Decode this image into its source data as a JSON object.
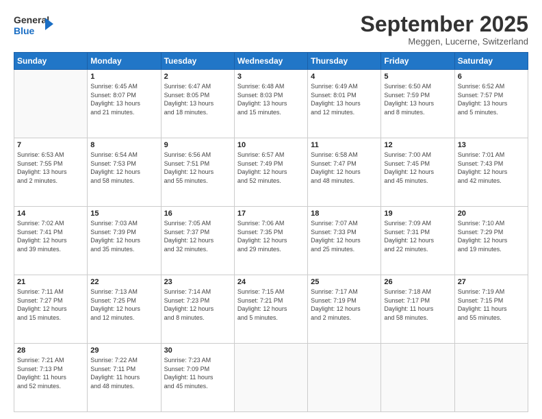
{
  "logo": {
    "line1": "General",
    "line2": "Blue"
  },
  "title": "September 2025",
  "subtitle": "Meggen, Lucerne, Switzerland",
  "header": {
    "days": [
      "Sunday",
      "Monday",
      "Tuesday",
      "Wednesday",
      "Thursday",
      "Friday",
      "Saturday"
    ]
  },
  "weeks": [
    [
      {
        "day": "",
        "info": ""
      },
      {
        "day": "1",
        "info": "Sunrise: 6:45 AM\nSunset: 8:07 PM\nDaylight: 13 hours\nand 21 minutes."
      },
      {
        "day": "2",
        "info": "Sunrise: 6:47 AM\nSunset: 8:05 PM\nDaylight: 13 hours\nand 18 minutes."
      },
      {
        "day": "3",
        "info": "Sunrise: 6:48 AM\nSunset: 8:03 PM\nDaylight: 13 hours\nand 15 minutes."
      },
      {
        "day": "4",
        "info": "Sunrise: 6:49 AM\nSunset: 8:01 PM\nDaylight: 13 hours\nand 12 minutes."
      },
      {
        "day": "5",
        "info": "Sunrise: 6:50 AM\nSunset: 7:59 PM\nDaylight: 13 hours\nand 8 minutes."
      },
      {
        "day": "6",
        "info": "Sunrise: 6:52 AM\nSunset: 7:57 PM\nDaylight: 13 hours\nand 5 minutes."
      }
    ],
    [
      {
        "day": "7",
        "info": "Sunrise: 6:53 AM\nSunset: 7:55 PM\nDaylight: 13 hours\nand 2 minutes."
      },
      {
        "day": "8",
        "info": "Sunrise: 6:54 AM\nSunset: 7:53 PM\nDaylight: 12 hours\nand 58 minutes."
      },
      {
        "day": "9",
        "info": "Sunrise: 6:56 AM\nSunset: 7:51 PM\nDaylight: 12 hours\nand 55 minutes."
      },
      {
        "day": "10",
        "info": "Sunrise: 6:57 AM\nSunset: 7:49 PM\nDaylight: 12 hours\nand 52 minutes."
      },
      {
        "day": "11",
        "info": "Sunrise: 6:58 AM\nSunset: 7:47 PM\nDaylight: 12 hours\nand 48 minutes."
      },
      {
        "day": "12",
        "info": "Sunrise: 7:00 AM\nSunset: 7:45 PM\nDaylight: 12 hours\nand 45 minutes."
      },
      {
        "day": "13",
        "info": "Sunrise: 7:01 AM\nSunset: 7:43 PM\nDaylight: 12 hours\nand 42 minutes."
      }
    ],
    [
      {
        "day": "14",
        "info": "Sunrise: 7:02 AM\nSunset: 7:41 PM\nDaylight: 12 hours\nand 39 minutes."
      },
      {
        "day": "15",
        "info": "Sunrise: 7:03 AM\nSunset: 7:39 PM\nDaylight: 12 hours\nand 35 minutes."
      },
      {
        "day": "16",
        "info": "Sunrise: 7:05 AM\nSunset: 7:37 PM\nDaylight: 12 hours\nand 32 minutes."
      },
      {
        "day": "17",
        "info": "Sunrise: 7:06 AM\nSunset: 7:35 PM\nDaylight: 12 hours\nand 29 minutes."
      },
      {
        "day": "18",
        "info": "Sunrise: 7:07 AM\nSunset: 7:33 PM\nDaylight: 12 hours\nand 25 minutes."
      },
      {
        "day": "19",
        "info": "Sunrise: 7:09 AM\nSunset: 7:31 PM\nDaylight: 12 hours\nand 22 minutes."
      },
      {
        "day": "20",
        "info": "Sunrise: 7:10 AM\nSunset: 7:29 PM\nDaylight: 12 hours\nand 19 minutes."
      }
    ],
    [
      {
        "day": "21",
        "info": "Sunrise: 7:11 AM\nSunset: 7:27 PM\nDaylight: 12 hours\nand 15 minutes."
      },
      {
        "day": "22",
        "info": "Sunrise: 7:13 AM\nSunset: 7:25 PM\nDaylight: 12 hours\nand 12 minutes."
      },
      {
        "day": "23",
        "info": "Sunrise: 7:14 AM\nSunset: 7:23 PM\nDaylight: 12 hours\nand 8 minutes."
      },
      {
        "day": "24",
        "info": "Sunrise: 7:15 AM\nSunset: 7:21 PM\nDaylight: 12 hours\nand 5 minutes."
      },
      {
        "day": "25",
        "info": "Sunrise: 7:17 AM\nSunset: 7:19 PM\nDaylight: 12 hours\nand 2 minutes."
      },
      {
        "day": "26",
        "info": "Sunrise: 7:18 AM\nSunset: 7:17 PM\nDaylight: 11 hours\nand 58 minutes."
      },
      {
        "day": "27",
        "info": "Sunrise: 7:19 AM\nSunset: 7:15 PM\nDaylight: 11 hours\nand 55 minutes."
      }
    ],
    [
      {
        "day": "28",
        "info": "Sunrise: 7:21 AM\nSunset: 7:13 PM\nDaylight: 11 hours\nand 52 minutes."
      },
      {
        "day": "29",
        "info": "Sunrise: 7:22 AM\nSunset: 7:11 PM\nDaylight: 11 hours\nand 48 minutes."
      },
      {
        "day": "30",
        "info": "Sunrise: 7:23 AM\nSunset: 7:09 PM\nDaylight: 11 hours\nand 45 minutes."
      },
      {
        "day": "",
        "info": ""
      },
      {
        "day": "",
        "info": ""
      },
      {
        "day": "",
        "info": ""
      },
      {
        "day": "",
        "info": ""
      }
    ]
  ]
}
